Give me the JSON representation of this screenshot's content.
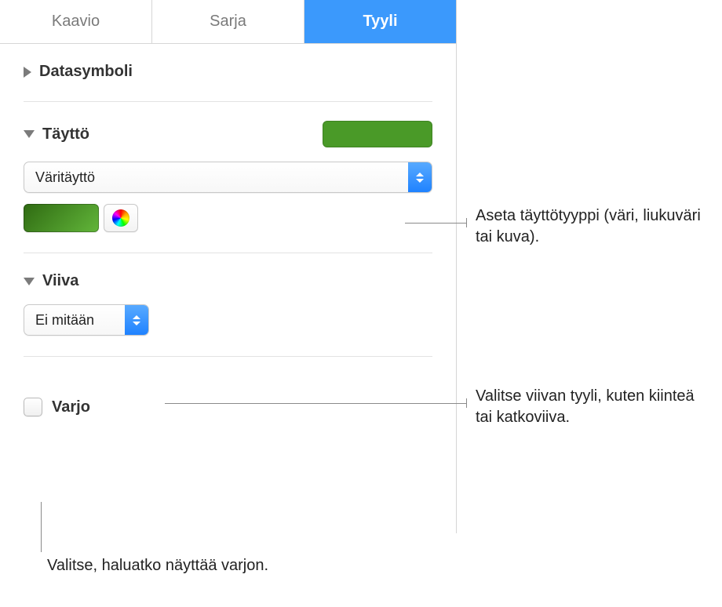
{
  "tabs": {
    "chart": "Kaavio",
    "series": "Sarja",
    "style": "Tyyli"
  },
  "sections": {
    "datasymbol": {
      "title": "Datasymboli"
    },
    "fill": {
      "title": "Täyttö",
      "swatch_color": "#4a9a28",
      "type_popup": "Väritäyttö"
    },
    "stroke": {
      "title": "Viiva",
      "style_popup": "Ei mitään"
    },
    "shadow": {
      "label": "Varjo",
      "checked": false
    }
  },
  "callouts": {
    "fill_type": "Aseta täyttötyyppi (väri, liukuväri tai kuva).",
    "stroke_style": "Valitse viivan tyyli, kuten kiinteä tai katkoviiva.",
    "shadow": "Valitse, haluatko näyttää varjon."
  }
}
